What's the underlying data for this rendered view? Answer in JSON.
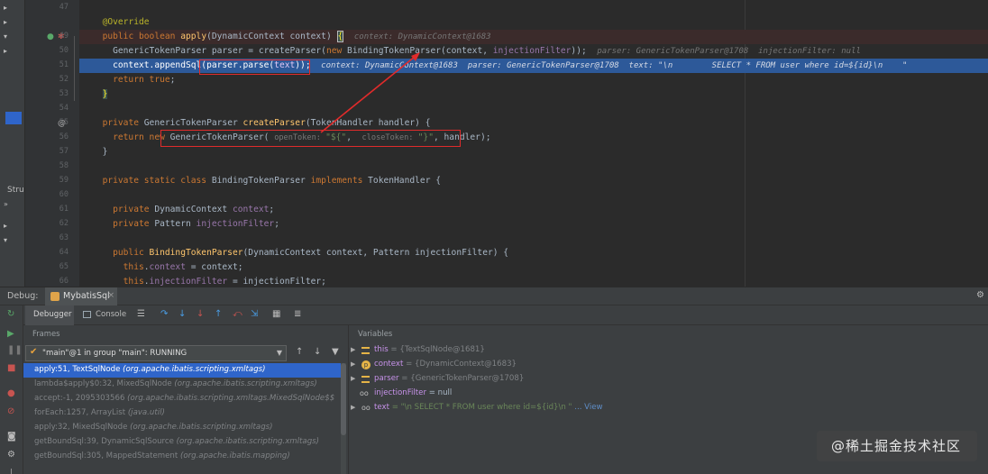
{
  "editor": {
    "lines": [
      {
        "num": "47"
      },
      {
        "num": "49"
      },
      {
        "num": "50"
      },
      {
        "num": "51"
      },
      {
        "num": "52"
      },
      {
        "num": "53"
      },
      {
        "num": "54"
      },
      {
        "num": "55"
      },
      {
        "num": "56"
      },
      {
        "num": "57"
      },
      {
        "num": "58"
      },
      {
        "num": "59"
      },
      {
        "num": "60"
      },
      {
        "num": "61"
      },
      {
        "num": "62"
      },
      {
        "num": "63"
      },
      {
        "num": "64"
      },
      {
        "num": "65"
      },
      {
        "num": "66"
      }
    ],
    "code": {
      "l48_override": "@Override",
      "l49_a": "public ",
      "l49_b": "boolean ",
      "l49_c": "apply",
      "l49_d": "(DynamicContext context) ",
      "l49_brace": "{",
      "l49_hint": "context: DynamicContext@1683",
      "l50_a": "GenericTokenParser parser = createParser(",
      "l50_new": "new ",
      "l50_b": "BindingTokenParser(context, ",
      "l50_fld": "injectionFilter",
      "l50_c": "));",
      "l50_hint": "parser: GenericTokenParser@1708  injectionFilter: null",
      "l51_a": "context.appendSql(parser.parse(",
      "l51_text": "text",
      "l51_b": "));",
      "l51_hint": "context: DynamicContext@1683  parser: GenericTokenParser@1708  text: \"\\n        SELECT * FROM user where id=${id}\\n    \"",
      "l52_kw": "return ",
      "l52_kw2": "true",
      "l52_end": ";",
      "l53": "}",
      "l55_a": "private ",
      "l55_b": "GenericTokenParser ",
      "l55_c": "createParser",
      "l55_d": "(TokenHandler handler) {",
      "l56_kw": "return new ",
      "l56_a": "GenericTokenParser( ",
      "l56_lbl1": "openToken: ",
      "l56_s1": "\"${\"",
      "l56_comma": ",  ",
      "l56_lbl2": "closeToken: ",
      "l56_s2": "\"}\"",
      "l56_b": ", handler);",
      "l57": "}",
      "l59_a": "private static class ",
      "l59_b": "BindingTokenParser ",
      "l59_c": "implements ",
      "l59_d": "TokenHandler {",
      "l61_a": "private ",
      "l61_b": "DynamicContext ",
      "l61_c": "context",
      "l61_d": ";",
      "l62_a": "private ",
      "l62_b": "Pattern ",
      "l62_c": "injectionFilter",
      "l62_d": ";",
      "l64_a": "public ",
      "l64_b": "BindingTokenParser",
      "l64_c": "(DynamicContext context, Pattern injectionFilter) {",
      "l65_a": "this",
      "l65_b": ".",
      "l65_c": "context",
      "l65_d": " = context;",
      "l66_a": "this",
      "l66_b": ".",
      "l66_c": "injectionFilter",
      "l66_d": " = injectionFilter;"
    },
    "sidebar_label": "Stru",
    "colors": {
      "selection": "#2d5999",
      "breakpoint_line": "#3b2b2b",
      "annotation_box": "#e02b2b"
    }
  },
  "debug": {
    "title": "Debug:",
    "session_tab": "MybatisSql",
    "tabs": {
      "debugger": "Debugger",
      "console": "Console"
    },
    "frames_label": "Frames",
    "variables_label": "Variables",
    "thread": "\"main\"@1 in group \"main\": RUNNING",
    "frames": [
      {
        "method": "apply:51, TextSqlNode ",
        "pkg": "(org.apache.ibatis.scripting.xmltags)"
      },
      {
        "method": "lambda$apply$0:32, MixedSqlNode ",
        "pkg": "(org.apache.ibatis.scripting.xmltags)"
      },
      {
        "method": "accept:-1, 2095303566 ",
        "pkg": "(org.apache.ibatis.scripting.xmltags.MixedSqlNode$$"
      },
      {
        "method": "forEach:1257, ArrayList ",
        "pkg": "(java.util)"
      },
      {
        "method": "apply:32, MixedSqlNode ",
        "pkg": "(org.apache.ibatis.scripting.xmltags)"
      },
      {
        "method": "getBoundSql:39, DynamicSqlSource ",
        "pkg": "(org.apache.ibatis.scripting.xmltags)"
      },
      {
        "method": "getBoundSql:305, MappedStatement ",
        "pkg": "(org.apache.ibatis.mapping)"
      }
    ],
    "variables": [
      {
        "name": "this",
        "value": " = {TextSqlNode@1681}"
      },
      {
        "name": "context",
        "value": " = {DynamicContext@1683}"
      },
      {
        "name": "parser",
        "value": " = {GenericTokenParser@1708}"
      },
      {
        "name": "injectionFilter",
        "value": " = null"
      },
      {
        "name": "text",
        "value_str": " = \"\\n        SELECT * FROM user where id=${id}\\n    \"",
        "link": " ... View"
      }
    ]
  },
  "watermark": "@稀土掘金技术社区"
}
